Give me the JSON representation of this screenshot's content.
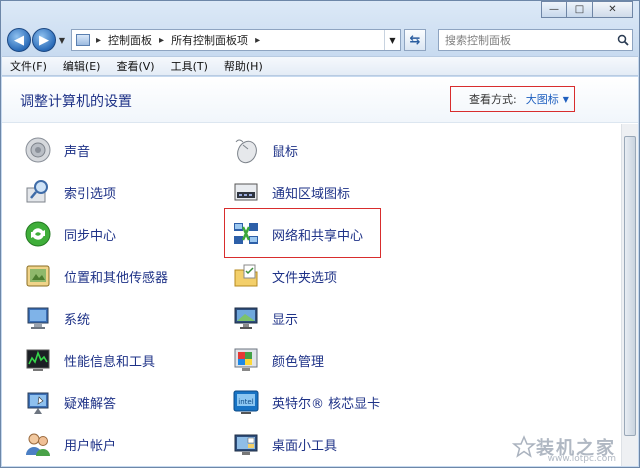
{
  "window": {
    "caption": {
      "minimize": "—",
      "maximize": "□",
      "close": "✕"
    }
  },
  "nav": {
    "back": "◀",
    "forward": "▶",
    "breadcrumbs": [
      "控制面板",
      "所有控制面板项"
    ],
    "search_placeholder": "搜索控制面板"
  },
  "menu": [
    "文件(F)",
    "编辑(E)",
    "查看(V)",
    "工具(T)",
    "帮助(H)"
  ],
  "header": {
    "title": "调整计算机的设置",
    "view_by_label": "查看方式:",
    "view_by_value": "大图标"
  },
  "items_left": [
    {
      "label": "声音",
      "icon": "speaker-icon"
    },
    {
      "label": "索引选项",
      "icon": "index-search-icon"
    },
    {
      "label": "同步中心",
      "icon": "sync-icon"
    },
    {
      "label": "位置和其他传感器",
      "icon": "sensor-icon"
    },
    {
      "label": "系统",
      "icon": "computer-icon"
    },
    {
      "label": "性能信息和工具",
      "icon": "performance-icon"
    },
    {
      "label": "疑难解答",
      "icon": "troubleshoot-icon"
    },
    {
      "label": "用户帐户",
      "icon": "users-icon"
    }
  ],
  "items_right": [
    {
      "label": "鼠标",
      "icon": "mouse-icon"
    },
    {
      "label": "通知区域图标",
      "icon": "notification-area-icon"
    },
    {
      "label": "网络和共享中心",
      "icon": "network-icon"
    },
    {
      "label": "文件夹选项",
      "icon": "folder-options-icon"
    },
    {
      "label": "显示",
      "icon": "display-icon"
    },
    {
      "label": "颜色管理",
      "icon": "color-management-icon"
    },
    {
      "label": "英特尔® 核芯显卡",
      "icon": "intel-graphics-icon"
    },
    {
      "label": "桌面小工具",
      "icon": "gadgets-icon"
    }
  ],
  "watermark": {
    "text": "装机之家",
    "url": "www.lotpc.com"
  }
}
